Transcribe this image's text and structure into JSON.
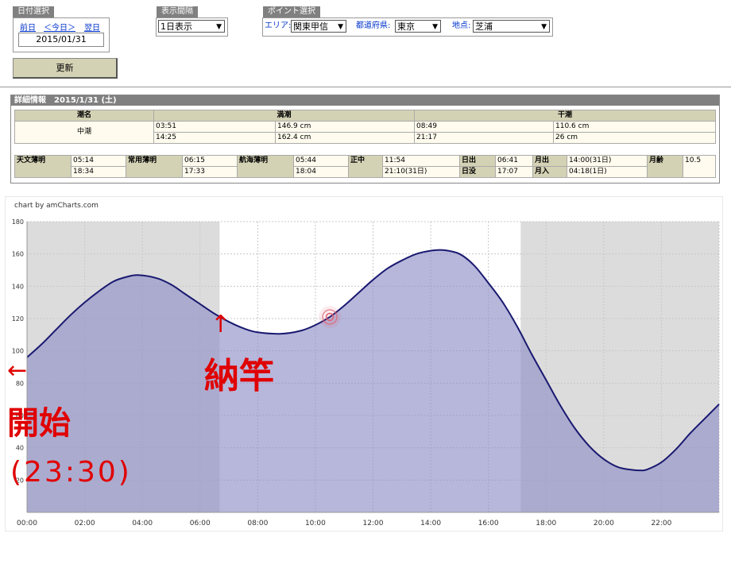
{
  "date_select": {
    "title": "日付選択",
    "prev": "前日",
    "today": "＜今日＞",
    "next": "翌日",
    "date_value": "2015/01/31"
  },
  "interval_select": {
    "title": "表示間隔",
    "value": "1日表示"
  },
  "point_select": {
    "title": "ポイント選択",
    "area_label": "エリア:",
    "area_value": "関東甲信",
    "pref_label": "都道府県:",
    "pref_value": "東京",
    "spot_label": "地点:",
    "spot_value": "芝浦"
  },
  "update_button": "更新",
  "detail": {
    "title": "詳細情報　2015/1/31 (土)",
    "tide_name_header": "潮名",
    "high_header": "満潮",
    "low_header": "干潮",
    "tide_name": "中潮",
    "high": [
      {
        "time": "03:51",
        "level": "146.9 cm"
      },
      {
        "time": "14:25",
        "level": "162.4 cm"
      }
    ],
    "low": [
      {
        "time": "08:49",
        "level": "110.6 cm"
      },
      {
        "time": "21:17",
        "level": "26 cm"
      }
    ],
    "astro": [
      {
        "label": "天文薄明",
        "v1": "05:14",
        "v2": "18:34"
      },
      {
        "label": "常用薄明",
        "v1": "06:15",
        "v2": "17:33"
      },
      {
        "label": "航海薄明",
        "v1": "05:44",
        "v2": "18:04"
      },
      {
        "label": "正中",
        "v1": "11:54",
        "v2": "21:10(31日)"
      }
    ],
    "sun_rise_label": "日出",
    "sun_rise": "06:41",
    "sun_set_label": "日没",
    "sun_set": "17:07",
    "moon_rise_label": "月出",
    "moon_rise": "14:00(31日)",
    "moon_set_label": "月入",
    "moon_set": "04:18(1日)",
    "moon_age_label": "月齢",
    "moon_age": "10.5"
  },
  "chart_data": {
    "type": "area",
    "credit": "chart by amCharts.com",
    "ylim": [
      0,
      180
    ],
    "y_ticks": [
      20,
      40,
      60,
      80,
      100,
      120,
      140,
      160,
      180
    ],
    "x_ticks": [
      "00:00",
      "02:00",
      "04:00",
      "06:00",
      "08:00",
      "10:00",
      "12:00",
      "14:00",
      "16:00",
      "18:00",
      "20:00",
      "22:00"
    ],
    "xlim_hours": [
      0,
      24
    ],
    "night_bands": [
      [
        0,
        6.68
      ],
      [
        17.12,
        24
      ]
    ],
    "series": [
      {
        "x_hours": [
          0,
          0.5,
          1,
          1.5,
          2,
          2.5,
          3,
          3.5,
          3.85,
          4.5,
          5,
          5.5,
          6,
          6.5,
          7,
          7.5,
          8,
          8.82,
          9.5,
          10,
          10.5,
          11,
          11.5,
          12,
          12.5,
          13,
          13.5,
          14,
          14.42,
          15,
          15.5,
          16,
          16.5,
          17,
          17.5,
          18,
          18.5,
          19,
          19.5,
          20,
          20.5,
          21,
          21.28,
          21.5,
          22,
          22.5,
          23,
          23.5,
          24
        ],
        "values": [
          96,
          104,
          113,
          122,
          130,
          137,
          143,
          146,
          146.9,
          145,
          141,
          135,
          129,
          123,
          118,
          114,
          111.5,
          110.6,
          112.5,
          116,
          121,
          128,
          136,
          144,
          151,
          156,
          160,
          162,
          162.4,
          160,
          153,
          142,
          130,
          115,
          98,
          82,
          66,
          52,
          41,
          33,
          28,
          26.3,
          26,
          26.5,
          31,
          39,
          49,
          58,
          67
        ]
      }
    ],
    "colors": {
      "line": "#191970",
      "fill": "#9090c8",
      "night": "#dcdcdc",
      "day": "#ffffff",
      "marker": "#e06070"
    },
    "annotations": [
      {
        "text": "開始",
        "note_time": "(23:30)",
        "label": "←"
      },
      {
        "text": "納竿",
        "label": "↑"
      }
    ]
  }
}
